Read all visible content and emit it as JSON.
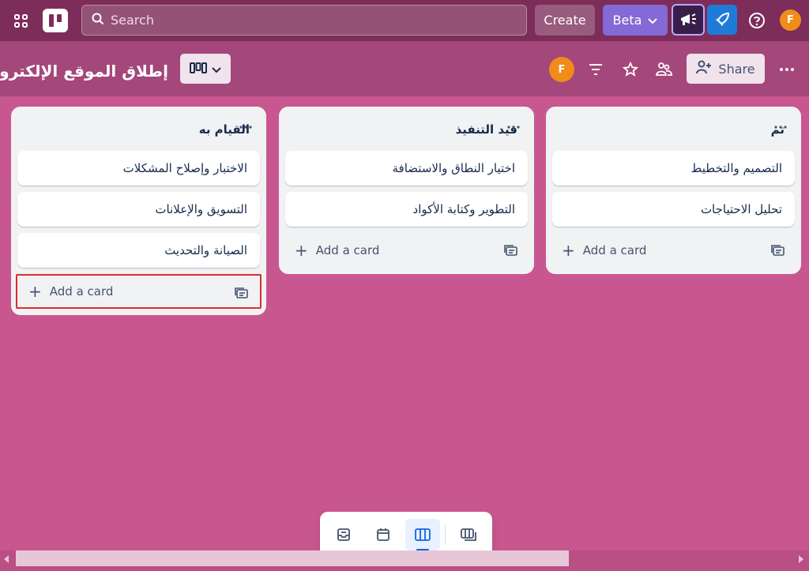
{
  "topnav": {
    "search_placeholder": "Search",
    "create_label": "Create",
    "beta_label": "Beta",
    "avatar_initial": "F"
  },
  "board": {
    "title": "إطلاق الموقع الإلكتروني",
    "member_initial": "F",
    "share_label": "Share"
  },
  "lists": [
    {
      "title": "القيام به",
      "cards": [
        "الاختبار وإصلاح المشكلات",
        "التسويق والإعلانات",
        "الصيانة والتحديث"
      ],
      "add_label": "Add a card"
    },
    {
      "title": "قيد التنفيذ",
      "cards": [
        "اختيار النطاق والاستضافة",
        "التطوير وكتابة الأكواد"
      ],
      "add_label": "Add a card"
    },
    {
      "title": "تم",
      "cards": [
        "التصميم والتخطيط",
        "تحليل الاحتياجات"
      ],
      "add_label": "Add a card"
    }
  ],
  "colors": {
    "topnav": "#7d2d5a",
    "boardbar": "#a4477a",
    "background": "#c9578f",
    "beta": "#8569d6",
    "avatar": "#f08c1a",
    "highlight": "#e02b2b"
  },
  "bottom_switcher": {
    "items": [
      "inbox-icon",
      "calendar-icon",
      "board-icon",
      "switch-boards-icon"
    ],
    "active": "board-icon"
  }
}
